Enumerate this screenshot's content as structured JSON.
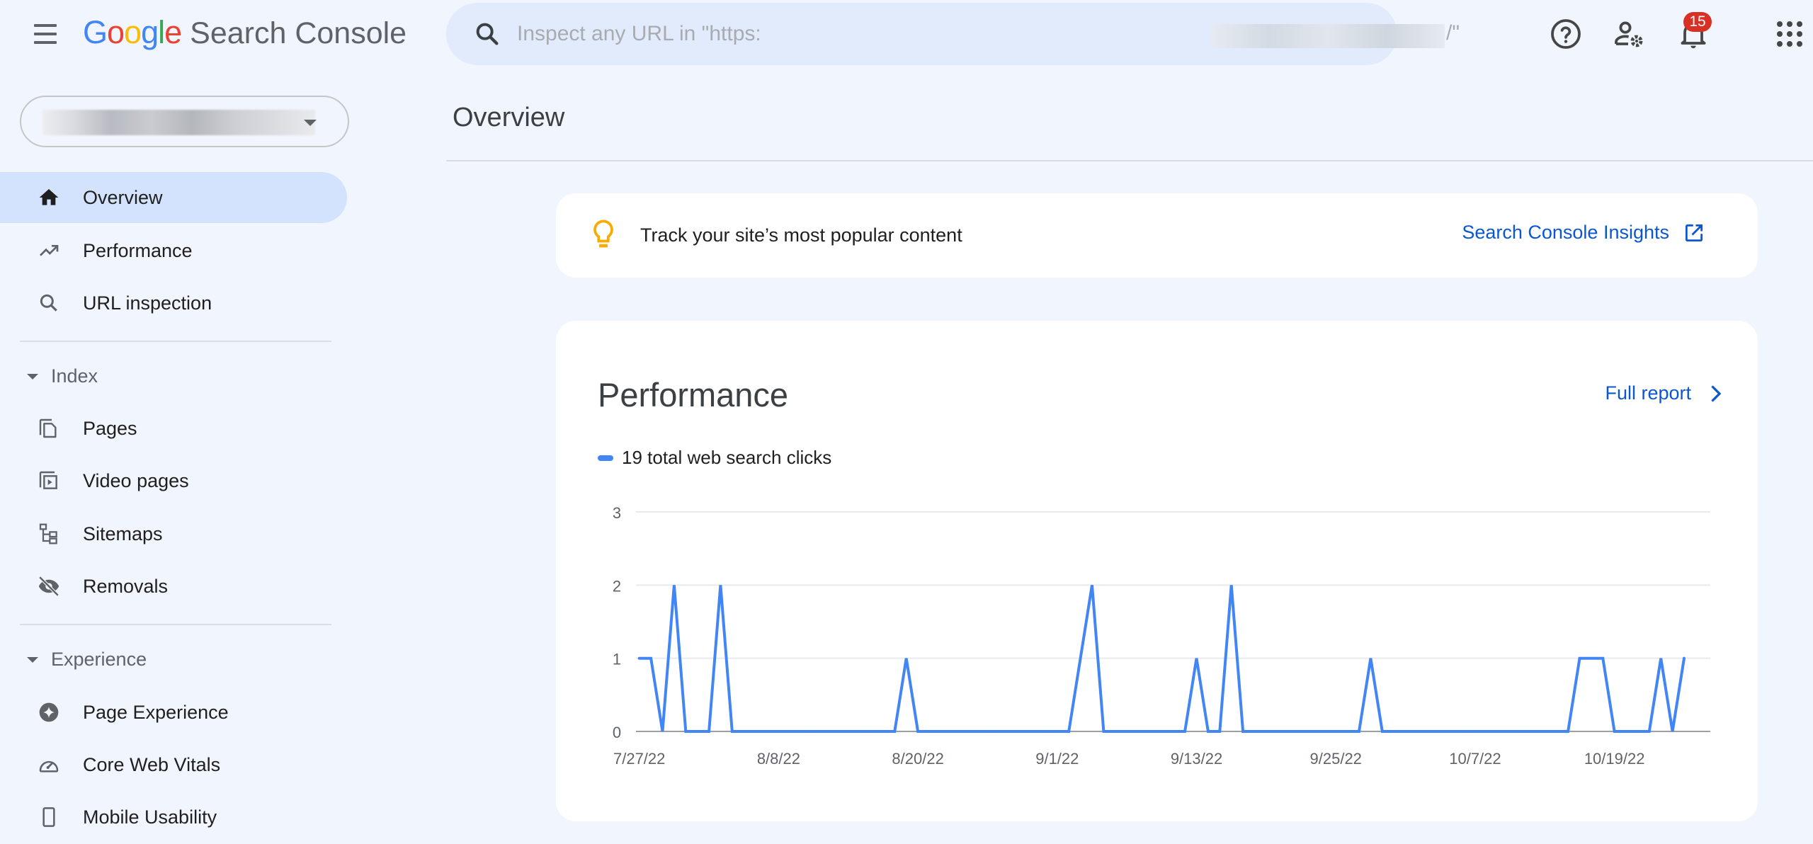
{
  "header": {
    "logo_letters": [
      {
        "ch": "G",
        "color": "#4285f4"
      },
      {
        "ch": "o",
        "color": "#ea4335"
      },
      {
        "ch": "o",
        "color": "#fbbc04"
      },
      {
        "ch": "g",
        "color": "#4285f4"
      },
      {
        "ch": "l",
        "color": "#34a853"
      },
      {
        "ch": "e",
        "color": "#ea4335"
      }
    ],
    "product_name": "Search Console",
    "search_placeholder": "Inspect any URL in \"https:",
    "search_placeholder_suffix": "/\"",
    "notification_count": "15",
    "icons": [
      "menu-icon",
      "search-icon",
      "help-icon",
      "manage-users-icon",
      "notifications-icon",
      "apps-icon"
    ]
  },
  "sidebar": {
    "property_selector": {
      "value": "(redacted)"
    },
    "items": [
      {
        "label": "Overview",
        "icon": "home-icon",
        "active": true
      },
      {
        "label": "Performance",
        "icon": "trending-up-icon"
      },
      {
        "label": "URL inspection",
        "icon": "search-icon"
      }
    ],
    "sections": [
      {
        "label": "Index",
        "expanded": true,
        "items": [
          {
            "label": "Pages",
            "icon": "pages-icon"
          },
          {
            "label": "Video pages",
            "icon": "video-pages-icon"
          },
          {
            "label": "Sitemaps",
            "icon": "sitemap-icon"
          },
          {
            "label": "Removals",
            "icon": "visibility-off-icon"
          }
        ]
      },
      {
        "label": "Experience",
        "expanded": true,
        "items": [
          {
            "label": "Page Experience",
            "icon": "page-experience-icon"
          },
          {
            "label": "Core Web Vitals",
            "icon": "speed-icon"
          },
          {
            "label": "Mobile Usability",
            "icon": "smartphone-icon"
          }
        ]
      }
    ]
  },
  "main": {
    "page_title": "Overview",
    "insight_card": {
      "text": "Track your site’s most popular content",
      "link_label": "Search Console Insights"
    },
    "performance_card": {
      "title": "Performance",
      "full_report_label": "Full report",
      "legend_label": "19 total web search clicks"
    }
  },
  "colors": {
    "accent": "#0b57d0",
    "line": "#4285f4",
    "active_nav": "#d3e3fd",
    "badge": "#d93025",
    "bulb": "#f9ab00"
  },
  "chart_data": {
    "type": "line",
    "title": "Performance",
    "series": [
      {
        "name": "19 total web search clicks",
        "color": "#4285f4",
        "start_date": "7/27/22",
        "end_date": "10/25/22",
        "values": [
          1,
          1,
          0,
          2,
          0,
          0,
          0,
          2,
          0,
          0,
          0,
          0,
          0,
          0,
          0,
          0,
          0,
          0,
          0,
          0,
          0,
          0,
          0,
          1,
          0,
          0,
          0,
          0,
          0,
          0,
          0,
          0,
          0,
          0,
          0,
          0,
          0,
          0,
          1,
          2,
          0,
          0,
          0,
          0,
          0,
          0,
          0,
          0,
          1,
          0,
          0,
          2,
          0,
          0,
          0,
          0,
          0,
          0,
          0,
          0,
          0,
          0,
          0,
          1,
          0,
          0,
          0,
          0,
          0,
          0,
          0,
          0,
          0,
          0,
          0,
          0,
          0,
          0,
          0,
          0,
          0,
          1,
          1,
          1,
          0,
          0,
          0,
          0,
          1,
          0,
          1
        ]
      }
    ],
    "x_tick_labels": [
      "7/27/22",
      "8/8/22",
      "8/20/22",
      "9/1/22",
      "9/13/22",
      "9/25/22",
      "10/7/22",
      "10/19/22"
    ],
    "x_tick_index": [
      0,
      12,
      24,
      36,
      48,
      60,
      72,
      84
    ],
    "y_ticks": [
      0,
      1,
      2,
      3
    ],
    "ylim": [
      0,
      3
    ],
    "xlabel": "",
    "ylabel": "",
    "grid": true,
    "legend": "top-left"
  }
}
